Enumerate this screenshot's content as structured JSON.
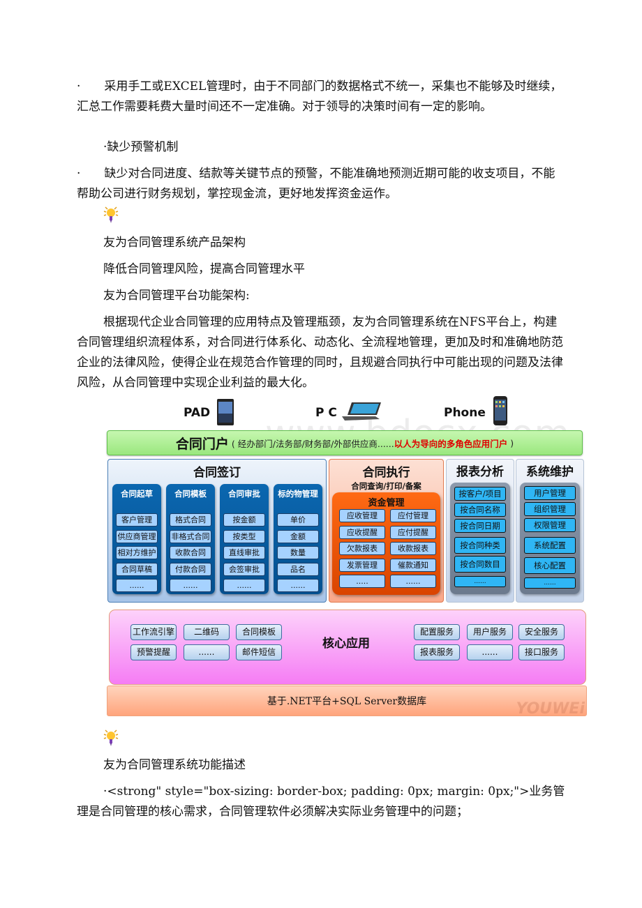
{
  "paragraphs": {
    "p1": "·　　采用手工或EXCEL管理时，由于不同部门的数据格式不统一，采集也不能够及时继续，汇总工作需要耗费大量时间还不一定准确。对于领导的决策时间有一定的影响。",
    "p2": "·缺少预警机制",
    "p3": "·　　缺少对合同进度、结款等关键节点的预警，不能准确地预测近期可能的收支项目，不能帮助公司进行财务规划，掌控现金流，更好地发挥资金运作。",
    "h1": "友为合同管理系统产品架构",
    "h2": "降低合同管理风险，提高合同管理水平",
    "h3": "友为合同管理平台功能架构:",
    "p4": "根据现代企业合同管理的应用特点及管理瓶颈，友为合同管理系统在NFS平台上，构建合同管理组织流程体系，对合同进行体系化、动态化、全流程地管理，更加及时和准确地防范企业的法律风险，使得企业在规范合作管理的同时，且规避合同执行中可能出现的问题及法律风险，从合同管理中实现企业利益的最大化。",
    "h4": "友为合同管理系统功能描述",
    "p5": "·<strong\" style=\"box-sizing: border-box; padding: 0px; margin: 0px;\">业务管理是合同管理的核心需求，合同管理软件必须解决实际业务管理中的问题；"
  },
  "icons": {
    "bulb": "lightbulb-icon"
  },
  "diagram": {
    "devices": {
      "pad": "PAD",
      "pc": "P C",
      "phone": "Phone"
    },
    "portal": {
      "title": "合同门户",
      "sub": "( 经办部门/法务部/财务部/外部供应商......",
      "red": "以人为导向的多角色应用门户",
      "close": " )"
    },
    "signing": {
      "title": "合同签订",
      "columns": [
        {
          "header": "合同起草",
          "items": [
            "客户管理",
            "供应商管理",
            "相对方维护",
            "合同草稿",
            "......"
          ]
        },
        {
          "header": "合同模板",
          "items": [
            "格式合同",
            "非格式合同",
            "收款合同",
            "付款合同",
            "......"
          ]
        },
        {
          "header": "合同审批",
          "items": [
            "按金额",
            "按类型",
            "直线审批",
            "会签审批",
            "......"
          ]
        },
        {
          "header": "标的物管理",
          "items": [
            "单价",
            "金额",
            "数量",
            "品名",
            "......"
          ]
        }
      ]
    },
    "execution": {
      "title": "合同执行",
      "subtitle": "合同查询/打印/备案",
      "fund_title": "资金管理",
      "items": [
        "应收管理",
        "应付管理",
        "应收提醒",
        "应付提醒",
        "欠款报表",
        "收款报表",
        "发票管理",
        "催款通知",
        ".....",
        "......"
      ]
    },
    "reports": {
      "title": "报表分析",
      "items": [
        "按客户/项目",
        "按合同名称",
        "按合同日期",
        "按合同种类",
        "按合同数目",
        "......"
      ]
    },
    "system": {
      "title": "系统维护",
      "items": [
        "用户管理",
        "组织管理",
        "权限管理",
        "系统配置",
        "核心配置",
        "......"
      ]
    },
    "core": {
      "title": "核心应用",
      "left": [
        "工作流引擎",
        "二维码",
        "合同模板",
        "预警提醒",
        "......",
        "邮件短信"
      ],
      "right": [
        "配置服务",
        "用户服务",
        "安全服务",
        "报表服务",
        "......",
        "接口服务"
      ]
    },
    "base": "基于.NET平台+SQL Server数据库",
    "watermark_logo": "YOUWEi",
    "watermark_site": "www.bdocx.com"
  },
  "colors": {
    "portal_red": "#e00000",
    "column_blue": "#0b67b0",
    "fund_orange": "#ff6a14",
    "chip_cyan": "#2fb6f5"
  }
}
